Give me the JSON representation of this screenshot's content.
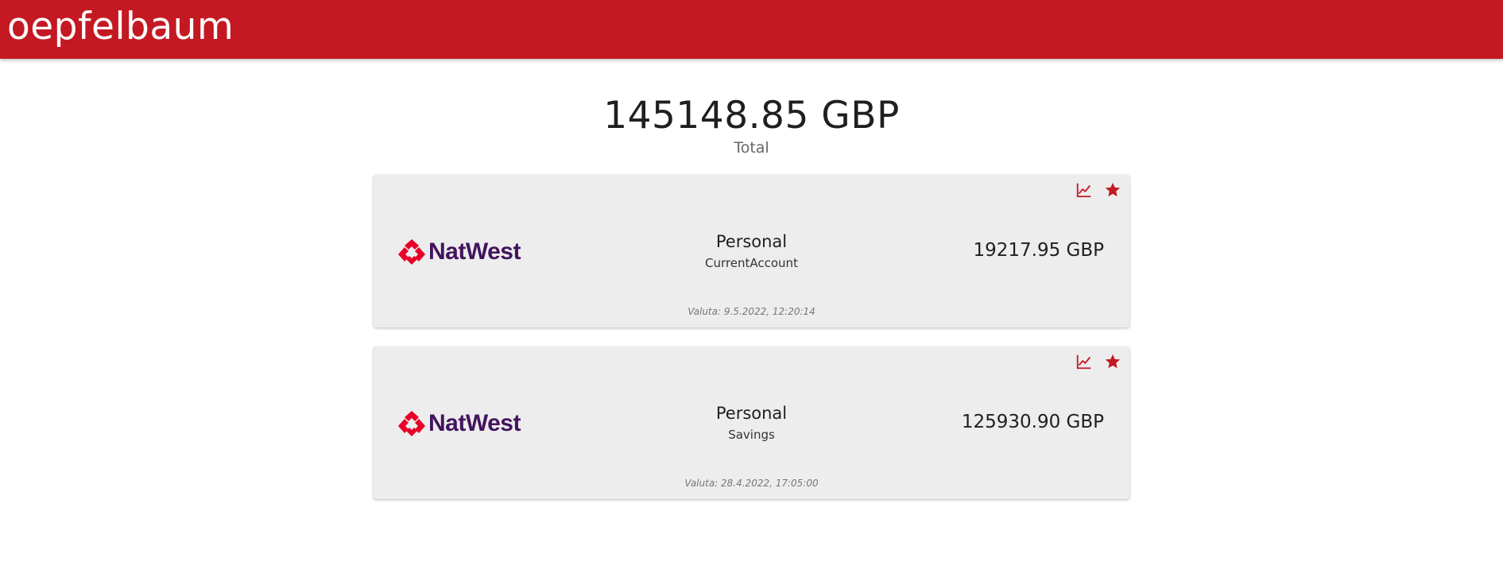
{
  "app": {
    "title": "oepfelbaum",
    "brand_color": "#c41922"
  },
  "summary": {
    "total": "145148.85 GBP",
    "label": "Total"
  },
  "accounts": [
    {
      "bank": "NatWest",
      "bank_logo_icon": "natwest-cubes-icon",
      "type": "Personal",
      "kind": "CurrentAccount",
      "balance": "19217.95 GBP",
      "valuta": "Valuta: 9.5.2022, 12:20:14",
      "actions": [
        "chart-icon",
        "star-icon"
      ]
    },
    {
      "bank": "NatWest",
      "bank_logo_icon": "natwest-cubes-icon",
      "type": "Personal",
      "kind": "Savings",
      "balance": "125930.90 GBP",
      "valuta": "Valuta: 28.4.2022, 17:05:00",
      "actions": [
        "chart-icon",
        "star-icon"
      ]
    }
  ],
  "colors": {
    "card_background": "#ededed",
    "icon_color": "#c41922",
    "bank_text_color": "#42145f"
  }
}
